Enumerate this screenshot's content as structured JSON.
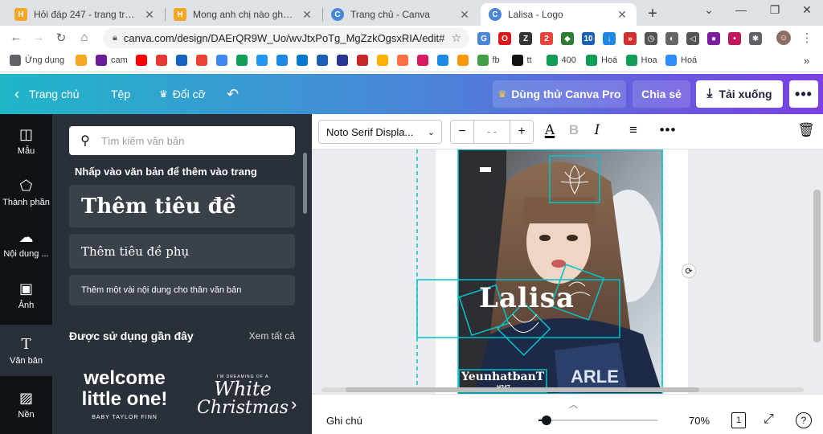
{
  "browser": {
    "tabs": [
      {
        "title": "Hỏi đáp 247 - trang tra loi",
        "icon": "hoidap-icon",
        "color": "#f5a623"
      },
      {
        "title": "Mong anh chị nào ghép cho",
        "icon": "hoidap-icon",
        "color": "#f5a623"
      },
      {
        "title": "Trang chủ - Canva",
        "icon": "canva-icon",
        "color": "#00c4cc"
      },
      {
        "title": "Lalisa - Logo",
        "icon": "canva-icon",
        "color": "#00c4cc"
      }
    ],
    "url": "canva.com/design/DAErQR9W_Uo/wvJtxPoTg_MgZzkOgsxRIA/edit#",
    "extensions": [
      {
        "icon": "translate-ext-icon",
        "color": "#4a86d8",
        "text": "G"
      },
      {
        "icon": "opera-ext-icon",
        "color": "#e0161b",
        "text": "O"
      },
      {
        "icon": "z-ext-icon",
        "color": "#333333",
        "text": "Z"
      },
      {
        "icon": "two-ext-icon",
        "color": "#e8453c",
        "text": "2"
      },
      {
        "icon": "vpn-ext-icon",
        "color": "#2e7d32",
        "text": "◆"
      },
      {
        "icon": "ten-ext-icon",
        "color": "#1a5fb4",
        "text": "10"
      },
      {
        "icon": "download-ext-icon",
        "color": "#1e88e5",
        "text": "↓"
      },
      {
        "icon": "ff-ext-icon",
        "color": "#d32f2f",
        "text": "»"
      },
      {
        "icon": "clock-ext-icon",
        "color": "#555555",
        "text": "◷"
      },
      {
        "icon": "mouse-ext-icon",
        "color": "#666666",
        "text": "◐"
      },
      {
        "icon": "speaker-ext-icon",
        "color": "#555555",
        "text": "◁"
      },
      {
        "icon": "record-ext-icon",
        "color": "#7b1fa2",
        "text": "●"
      },
      {
        "icon": "dot-ext-icon",
        "color": "#c2185b",
        "text": "•"
      },
      {
        "icon": "puzzle-ext-icon",
        "color": "#5f6368",
        "text": "✱"
      }
    ],
    "bookmarks": [
      {
        "label": "Ứng dụng",
        "icon": "apps-grid-icon",
        "color": "#5f6368"
      },
      {
        "label": "",
        "icon": "hoidap-bm-icon",
        "color": "#f5a623"
      },
      {
        "label": "cam",
        "icon": "cam-bm-icon",
        "color": "#6a1b9a"
      },
      {
        "label": "",
        "icon": "youtube-bm-icon",
        "color": "#ff0000"
      },
      {
        "label": "",
        "icon": "51-bm-icon",
        "color": "#e53935"
      },
      {
        "label": "",
        "icon": "box-bm-icon",
        "color": "#1565c0"
      },
      {
        "label": "",
        "icon": "gmail-bm-icon",
        "color": "#ea4335"
      },
      {
        "label": "",
        "icon": "translate-bm-icon",
        "color": "#4285f4"
      },
      {
        "label": "",
        "icon": "drive-bm-icon",
        "color": "#0f9d58"
      },
      {
        "label": "",
        "icon": "s-bm-icon",
        "color": "#2196f3"
      },
      {
        "label": "",
        "icon": "h-bm-icon",
        "color": "#1e88e5"
      },
      {
        "label": "",
        "icon": "outlook-bm-icon",
        "color": "#0078d4"
      },
      {
        "label": "",
        "icon": "ten-bm-icon",
        "color": "#1a5fb4"
      },
      {
        "label": "",
        "icon": "flag-bm-icon",
        "color": "#283593"
      },
      {
        "label": "",
        "icon": "uni-bm-icon",
        "color": "#c62828"
      },
      {
        "label": "",
        "icon": "pinwheel-bm-icon",
        "color": "#ffb300"
      },
      {
        "label": "",
        "icon": "face-bm-icon",
        "color": "#ff7043"
      },
      {
        "label": "",
        "icon": "instagram-bm-icon",
        "color": "#d81b60"
      },
      {
        "label": "",
        "icon": "l-bm-icon",
        "color": "#1e88e5"
      },
      {
        "label": "",
        "icon": "j-bm-icon",
        "color": "#ff9800"
      },
      {
        "label": "fb",
        "icon": "arrow-bm-icon",
        "color": "#43a047"
      },
      {
        "label": "tt",
        "icon": "tiktok-bm-icon",
        "color": "#111111"
      },
      {
        "label": "400",
        "icon": "drive-bm-icon",
        "color": "#0f9d58"
      },
      {
        "label": "Hoá",
        "icon": "drive-bm-icon",
        "color": "#0f9d58"
      },
      {
        "label": "Hoa",
        "icon": "drive-bm-icon",
        "color": "#0f9d58"
      },
      {
        "label": "Hoá",
        "icon": "zoom-bm-icon",
        "color": "#2d8cff"
      }
    ]
  },
  "header": {
    "home": "Trang chủ",
    "file": "Tệp",
    "resize": "Đổi cỡ",
    "try_pro": "Dùng thử Canva Pro",
    "share": "Chia sẻ",
    "download": "Tải xuống"
  },
  "rail": [
    {
      "label": "Mẫu",
      "icon": "template-icon"
    },
    {
      "label": "Thành phần",
      "icon": "elements-icon"
    },
    {
      "label": "Nội dung ...",
      "icon": "upload-icon"
    },
    {
      "label": "Ảnh",
      "icon": "photo-icon"
    },
    {
      "label": "Văn bản",
      "icon": "text-icon"
    },
    {
      "label": "Nền",
      "icon": "background-icon"
    }
  ],
  "panel": {
    "search_placeholder": "Tìm kiếm văn bản",
    "hint": "Nhấp vào văn bản để thêm vào trang",
    "heading": "Thêm tiêu đề",
    "subheading": "Thêm tiêu đề phụ",
    "body": "Thêm một vài nội dung cho thân văn bản",
    "recent_title": "Được sử dụng gần đây",
    "see_all": "Xem tất cả",
    "tile1_line1": "welcome",
    "tile1_line2": "little one!",
    "tile1_caption": "BABY TAYLOR FINN",
    "tile2_top": "I'M DREAMING OF A",
    "tile2_line1": "White",
    "tile2_line2": "Christmas"
  },
  "toolbar": {
    "font": "Noto Serif Displa...",
    "size": "- -"
  },
  "design": {
    "title_text": "Lalisa",
    "footer_text": "YeunhatbanT",
    "small_text": "H247",
    "accent": "#00c4cc"
  },
  "bottom": {
    "notes": "Ghi chú",
    "zoom": "70%",
    "zoom_fraction": 0.07,
    "page": "1"
  }
}
